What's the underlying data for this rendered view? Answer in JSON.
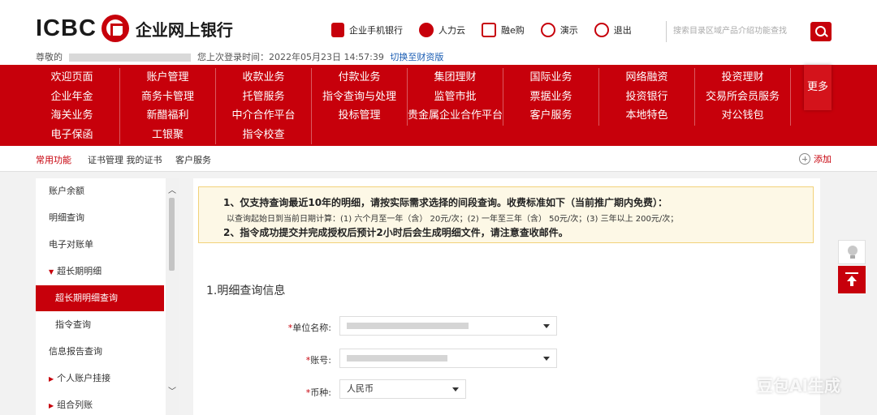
{
  "header": {
    "logo_text": "ICBC",
    "logo_cn": "企业网上银行",
    "welcome_prefix": "尊敬的",
    "last_login": "您上次登录时间：2022年05月23日 14:57:39",
    "switch_link": "切换至财资版",
    "links": [
      {
        "label": "企业手机银行",
        "icon": "mobile-bank-icon"
      },
      {
        "label": "人力云",
        "icon": "cloud-icon"
      },
      {
        "label": "融e购",
        "icon": "cart-icon"
      },
      {
        "label": "演示",
        "icon": "demo-icon"
      },
      {
        "label": "退出",
        "icon": "power-icon"
      }
    ],
    "search_placeholder": "搜索目录区域产品介绍功能查找"
  },
  "menu": {
    "rows": [
      [
        "欢迎页面",
        "账户管理",
        "收款业务",
        "付款业务",
        "集团理财",
        "国际业务",
        "网络融资",
        "投资理财"
      ],
      [
        "企业年金",
        "商务卡管理",
        "托管服务",
        "指令查询与处理",
        "监管市批",
        "票据业务",
        "投资银行",
        "交易所会员服务"
      ],
      [
        "海关业务",
        "新醋福利",
        "中介合作平台",
        "投标管理",
        "贵金属企业合作平台",
        "客户服务",
        "本地特色",
        "对公钱包"
      ],
      [
        "电子保函",
        "工银聚",
        "指令校查",
        "",
        "",
        "",
        "",
        ""
      ]
    ],
    "more": "更多"
  },
  "quickbar": {
    "items": [
      "常用功能",
      "证书管理 我的证书",
      "客户服务"
    ],
    "add": "添加"
  },
  "sidebar": {
    "items": [
      {
        "label": "账户余额",
        "type": "normal"
      },
      {
        "label": "明细查询",
        "type": "normal"
      },
      {
        "label": "电子对账单",
        "type": "normal"
      },
      {
        "label": "超长期明细",
        "type": "expanded"
      },
      {
        "label": "超长期明细查询",
        "type": "active"
      },
      {
        "label": "指令查询",
        "type": "sub"
      },
      {
        "label": "信息报告查询",
        "type": "normal"
      },
      {
        "label": "个人账户挂接",
        "type": "collapsed"
      },
      {
        "label": "组合列账",
        "type": "collapsed"
      }
    ]
  },
  "notice": {
    "line1": "1、仅支持查询最近10年的明细，请按实际需求选择的间段查询。收费标准如下（当前推广期内免费）：",
    "line2": "以查询起始日到当前日期计算：(1) 六个月至一年（含） 20元/次；(2) 一年至三年（含） 50元/次；(3) 三年以上 200元/次；",
    "line3": "2、指令成功提交并完成授权后预计2小时后会生成明细文件，请注意查收邮件。"
  },
  "form": {
    "section_title": "1.明细查询信息",
    "unit_label": "单位名称:",
    "account_label": "账号:",
    "currency_label": "币种:",
    "currency_value": "人民币"
  },
  "watermark": "豆包AI生成"
}
